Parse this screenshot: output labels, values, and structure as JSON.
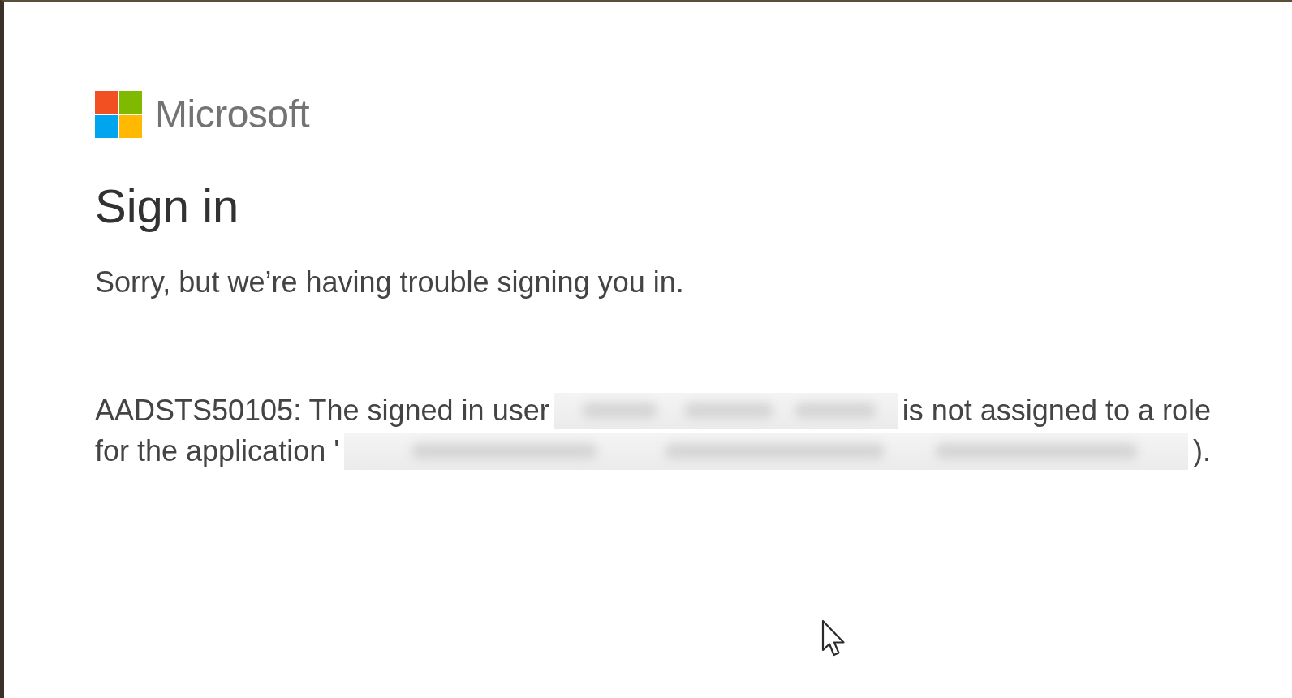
{
  "logo": {
    "wordmark": "Microsoft"
  },
  "title": "Sign in",
  "message": "Sorry, but we’re having trouble signing you in.",
  "error_message": {
    "lines": [
      [
        {
          "kind": "text",
          "text": "AADSTS50105: The signed in user"
        },
        {
          "kind": "redacted"
        },
        {
          "kind": "text",
          "text": "is not assigned to a role"
        }
      ],
      [
        {
          "kind": "text",
          "text": "for the application '"
        },
        {
          "kind": "redacted"
        },
        {
          "kind": "text",
          "text": ")."
        }
      ]
    ]
  }
}
